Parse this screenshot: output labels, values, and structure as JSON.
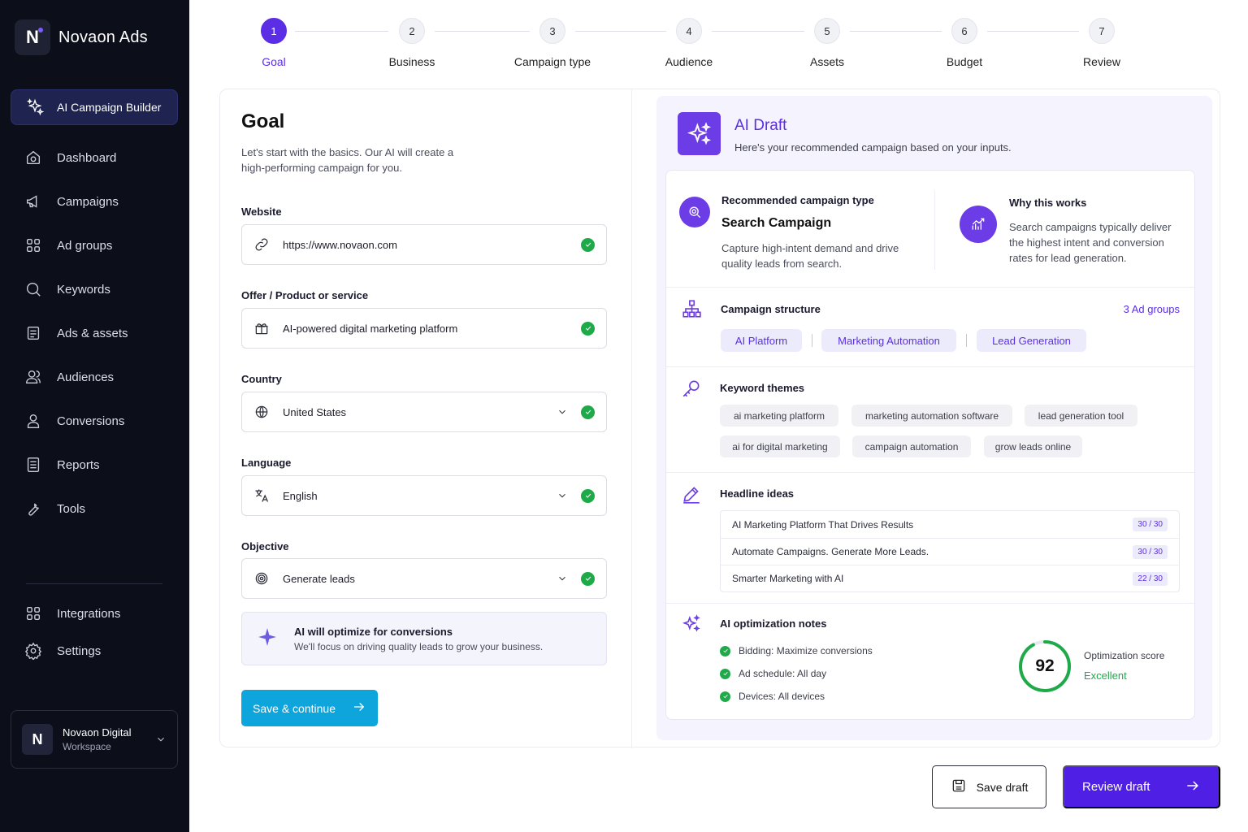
{
  "app": {
    "name": "Novaon Ads",
    "logo_letter": "N"
  },
  "sidebar": {
    "active": {
      "label": "AI Campaign Builder",
      "icon": "sparkles-icon"
    },
    "items": [
      {
        "label": "Dashboard",
        "icon": "home-icon"
      },
      {
        "label": "Campaigns",
        "icon": "megaphone-icon"
      },
      {
        "label": "Ad groups",
        "icon": "grid-icon"
      },
      {
        "label": "Keywords",
        "icon": "search-icon"
      },
      {
        "label": "Ads & assets",
        "icon": "document-icon"
      },
      {
        "label": "Audiences",
        "icon": "users-icon"
      },
      {
        "label": "Conversions",
        "icon": "user-icon"
      },
      {
        "label": "Reports",
        "icon": "report-icon"
      },
      {
        "label": "Tools",
        "icon": "wrench-icon"
      }
    ],
    "bottom_items": [
      {
        "label": "Integrations",
        "icon": "grid-icon"
      },
      {
        "label": "Settings",
        "icon": "gear-icon"
      }
    ],
    "workspace": {
      "letter": "N",
      "name": "Novaon Digital",
      "sub": "Workspace"
    }
  },
  "stepper": {
    "steps": [
      {
        "num": "1",
        "label": "Goal",
        "active": true
      },
      {
        "num": "2",
        "label": "Business"
      },
      {
        "num": "3",
        "label": "Campaign type"
      },
      {
        "num": "4",
        "label": "Audience"
      },
      {
        "num": "5",
        "label": "Assets"
      },
      {
        "num": "6",
        "label": "Budget"
      },
      {
        "num": "7",
        "label": "Review"
      }
    ]
  },
  "goal": {
    "title": "Goal",
    "description": "Let's start with the basics. Our AI will create a high-performing campaign for you.",
    "fields": {
      "website": {
        "label": "Website",
        "value": "https://www.novaon.com"
      },
      "offer": {
        "label": "Offer / Product or service",
        "value": "AI-powered digital marketing platform"
      },
      "country": {
        "label": "Country",
        "value": "United States"
      },
      "language": {
        "label": "Language",
        "value": "English"
      },
      "objective": {
        "label": "Objective",
        "value": "Generate leads"
      }
    },
    "ai_note": {
      "title": "AI will optimize for conversions",
      "sub": "We'll focus on driving quality leads to grow your business."
    },
    "save_continue": "Save & continue"
  },
  "draft": {
    "title": "AI Draft",
    "sub": "Here's your recommended campaign based on your inputs.",
    "recommended": {
      "label": "Recommended campaign type",
      "value": "Search Campaign",
      "desc": "Capture high-intent demand and drive quality leads from search."
    },
    "why": {
      "label": "Why this works",
      "desc": "Search campaigns typically deliver the highest intent and conversion rates for lead generation."
    },
    "structure": {
      "label": "Campaign structure",
      "count": "3 Ad groups",
      "groups": [
        "AI Platform",
        "Marketing Automation",
        "Lead Generation"
      ]
    },
    "keywords": {
      "label": "Keyword themes",
      "items": [
        "ai marketing platform",
        "marketing automation software",
        "lead generation tool",
        "ai for digital marketing",
        "campaign automation",
        "grow leads online"
      ]
    },
    "headlines": {
      "label": "Headline ideas",
      "items": [
        {
          "text": "AI Marketing Platform That Drives Results",
          "count": "30 / 30"
        },
        {
          "text": "Automate Campaigns. Generate More Leads.",
          "count": "30 / 30"
        },
        {
          "text": "Smarter Marketing with AI",
          "count": "22 / 30"
        }
      ]
    },
    "optimization": {
      "label": "AI optimization notes",
      "items": [
        "Bidding: Maximize conversions",
        "Ad schedule: All day",
        "Devices: All devices"
      ],
      "score": "92",
      "score_fraction": 0.92,
      "score_label": "Optimization score",
      "score_status": "Excellent"
    }
  },
  "actions": {
    "save_draft": "Save draft",
    "review_draft": "Review draft"
  },
  "colors": {
    "accent": "#5b2ee6",
    "success": "#1faa49",
    "cta": "#0ea5dc",
    "sidebar": "#0c0e1a"
  }
}
